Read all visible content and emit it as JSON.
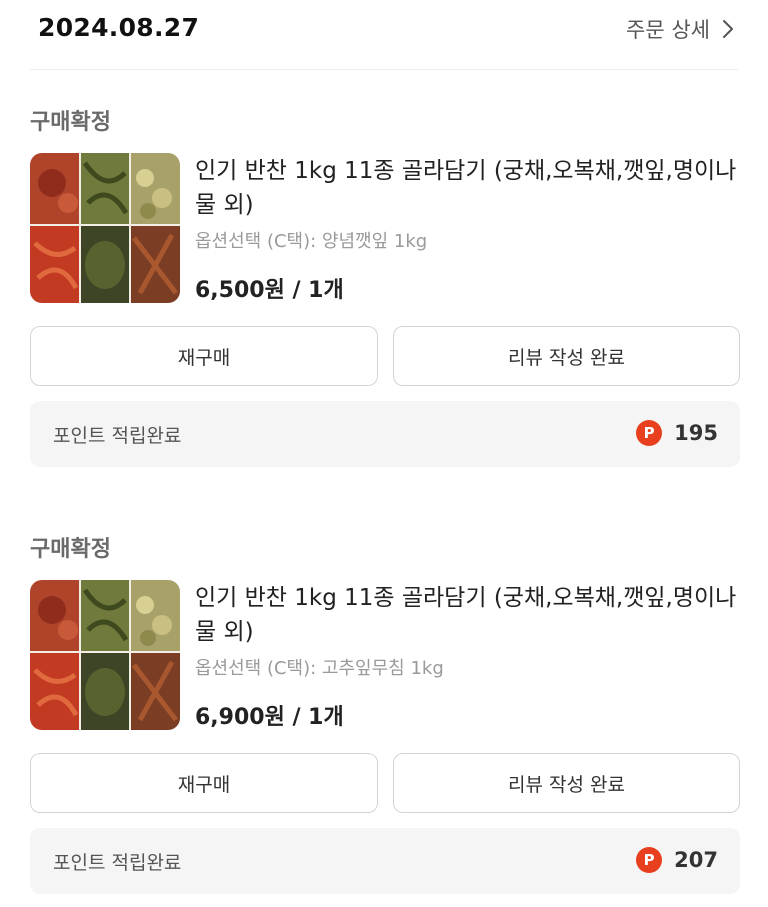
{
  "header": {
    "date": "2024.08.27",
    "detail_label": "주문 상세"
  },
  "orders": [
    {
      "status": "구매확정",
      "product_name": "인기 반찬 1kg 11종 골라담기 (궁채,오복채,깻잎,명이나물 외)",
      "option": "옵션선택 (C택): 양념깻잎 1kg",
      "price": "6,500원 / 1개",
      "rebuy_label": "재구매",
      "review_label": "리뷰 작성 완료",
      "points_label": "포인트 적립완료",
      "points_badge": "P",
      "points_value": "195"
    },
    {
      "status": "구매확정",
      "product_name": "인기 반찬 1kg 11종 골라담기 (궁채,오복채,깻잎,명이나물 외)",
      "option": "옵션선택 (C택): 고추잎무침 1kg",
      "price": "6,900원 / 1개",
      "rebuy_label": "재구매",
      "review_label": "리뷰 작성 완료",
      "points_label": "포인트 적립완료",
      "points_badge": "P",
      "points_value": "207"
    }
  ],
  "colors": {
    "status_text": "#6a6a6a",
    "points_badge": "#e8401f",
    "points_background": "#f5f5f5"
  },
  "icons": {
    "detail_arrow": "chevron-right-icon",
    "points_badge": "point-icon"
  }
}
